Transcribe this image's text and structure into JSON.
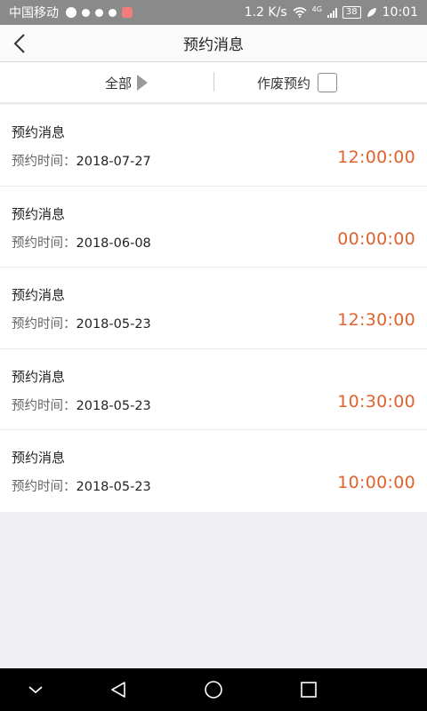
{
  "status_bar": {
    "carrier": "中国移动",
    "speed": "1.2 K/s",
    "network": "4G",
    "battery": "38",
    "time": "10:01"
  },
  "header": {
    "title": "预约消息",
    "back_icon": "chevron-left-icon"
  },
  "filter": {
    "all_label": "全部",
    "void_label": "作废预约",
    "void_checked": false
  },
  "appointments": [
    {
      "title": "预约消息",
      "date_label": "预约时间：",
      "date": "2018-07-27",
      "time": "12:00:00"
    },
    {
      "title": "预约消息",
      "date_label": "预约时间：",
      "date": "2018-06-08",
      "time": "00:00:00"
    },
    {
      "title": "预约消息",
      "date_label": "预约时间：",
      "date": "2018-05-23",
      "time": "12:30:00"
    },
    {
      "title": "预约消息",
      "date_label": "预约时间：",
      "date": "2018-05-23",
      "time": "10:30:00"
    },
    {
      "title": "预约消息",
      "date_label": "预约时间：",
      "date": "2018-05-23",
      "time": "10:00:00"
    }
  ],
  "nav_bar": {
    "icons": [
      "hide-keyboard-icon",
      "back-triangle-icon",
      "home-circle-icon",
      "recents-square-icon"
    ]
  },
  "colors": {
    "accent_time": "#e0622c",
    "status_bar_bg": "#8a8a8a",
    "background": "#efeef3"
  }
}
